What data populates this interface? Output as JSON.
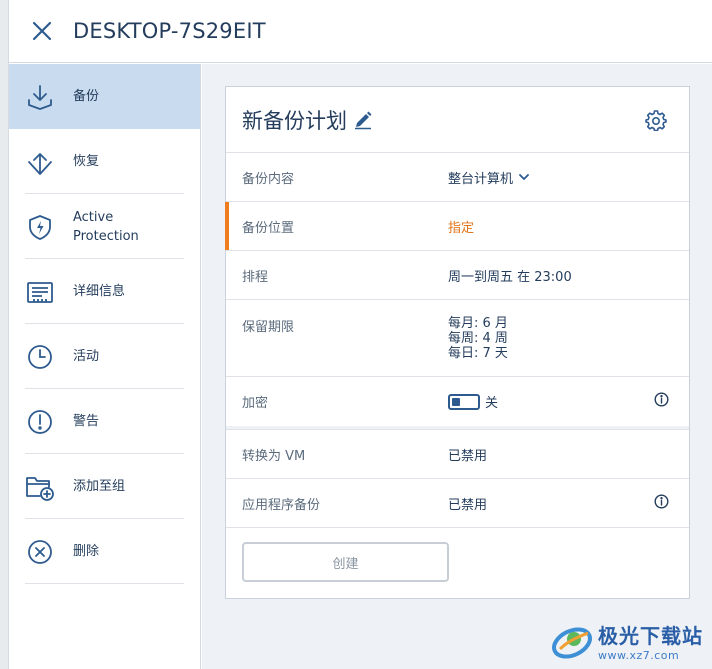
{
  "header": {
    "title": "DESKTOP-7S29EIT"
  },
  "sidebar": {
    "items": [
      {
        "label": "备份",
        "icon": "backup-icon",
        "active": true
      },
      {
        "label": "恢复",
        "icon": "restore-icon"
      },
      {
        "label": "Active Protection",
        "line1": "Active",
        "line2": "Protection",
        "icon": "shield-icon"
      },
      {
        "label": "详细信息",
        "icon": "details-icon"
      },
      {
        "label": "活动",
        "icon": "clock-icon"
      },
      {
        "label": "警告",
        "icon": "alert-icon"
      },
      {
        "label": "添加至组",
        "icon": "add-folder-icon"
      },
      {
        "label": "删除",
        "icon": "delete-icon"
      }
    ]
  },
  "plan": {
    "title": "新备份计划",
    "rows": {
      "content": {
        "label": "备份内容",
        "value": "整台计算机"
      },
      "location": {
        "label": "备份位置",
        "value": "指定"
      },
      "schedule": {
        "label": "排程",
        "value": "周一到周五 在 23:00"
      },
      "retention": {
        "label": "保留期限",
        "monthly": "每月: 6 月",
        "weekly": "每周: 4 周",
        "daily": "每日: 7 天"
      },
      "encryption": {
        "label": "加密",
        "toggle_text": "关"
      },
      "convert_vm": {
        "label": "转换为 VM",
        "value": "已禁用"
      },
      "app_backup": {
        "label": "应用程序备份",
        "value": "已禁用"
      }
    },
    "create_label": "创建"
  },
  "watermark": {
    "text": "极光下载站",
    "url": "www.xz7.com"
  },
  "colors": {
    "accent": "#2e5b8f",
    "active_bg": "#c9dbee",
    "warning": "#ef7d1d"
  }
}
